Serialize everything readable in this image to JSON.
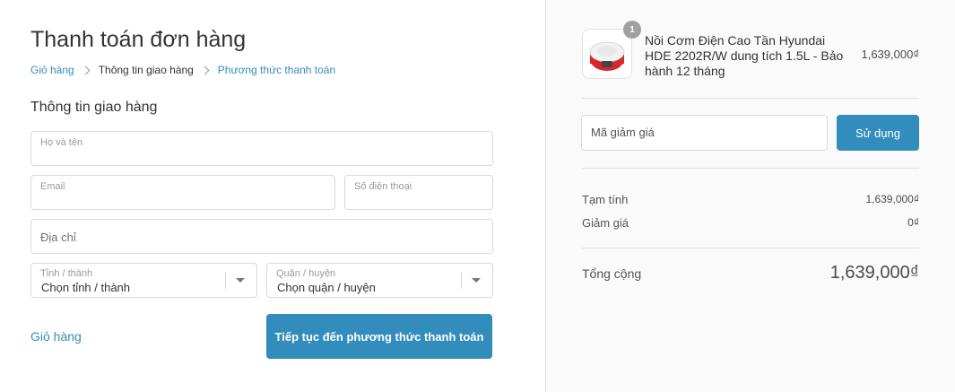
{
  "page": {
    "title": "Thanh toán đơn hàng",
    "breadcrumb": [
      {
        "label": "Giỏ hàng"
      },
      {
        "label": "Thông tin giao hàng"
      },
      {
        "label": "Phương thức thanh toán"
      }
    ],
    "section_title": "Thông tin giao hàng"
  },
  "form": {
    "fullname": {
      "label": "Họ và tên",
      "value": ""
    },
    "email": {
      "label": "Email",
      "value": ""
    },
    "phone": {
      "label": "Số điện thoại",
      "value": ""
    },
    "address": {
      "placeholder": "Địa chỉ",
      "value": ""
    },
    "province": {
      "label": "Tỉnh / thành",
      "selected": "Chọn tỉnh / thành"
    },
    "district": {
      "label": "Quận / huyện",
      "selected": "Chọn quận / huyện"
    }
  },
  "actions": {
    "back_label": "Giỏ hàng",
    "continue_label": "Tiếp tục đến phương thức thanh toán"
  },
  "summary": {
    "product": {
      "quantity": "1",
      "name": "Nồi Cơm Điện Cao Tần Hyundai HDE 2202R/W dung tích 1.5L - Bảo hành 12 tháng",
      "price": "1,639,000₫"
    },
    "discount": {
      "placeholder": "Mã giảm giá",
      "apply_label": "Sử dụng"
    },
    "subtotal_label": "Tạm tính",
    "subtotal_value": "1,639,000₫",
    "discount_label": "Giảm giá",
    "discount_value": "0₫",
    "total_label": "Tổng cộng",
    "total_value": "1,639,000₫"
  },
  "colors": {
    "accent": "#338dbc",
    "badge": "#a0a0a0",
    "product_red": "#d9262b"
  }
}
